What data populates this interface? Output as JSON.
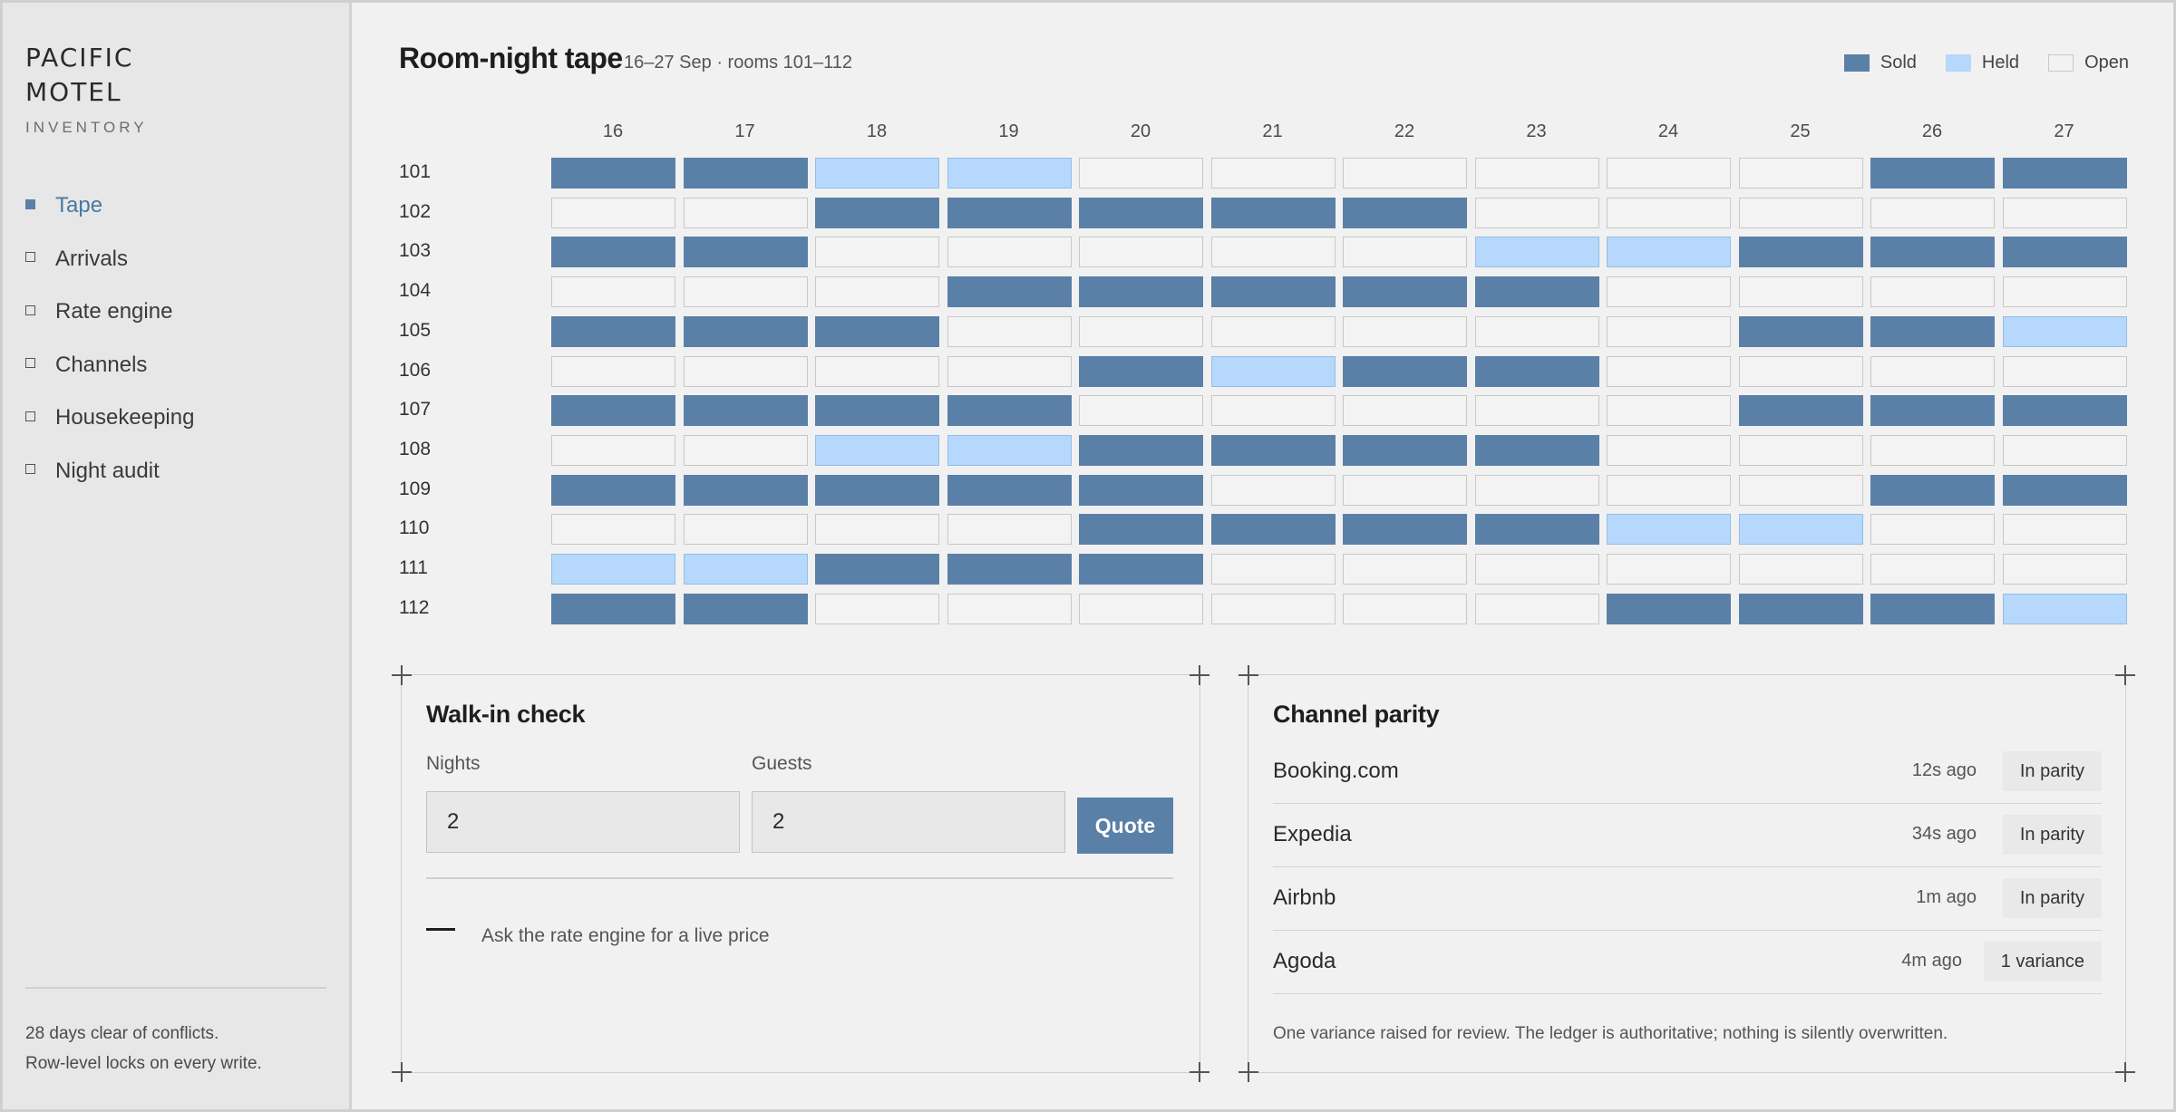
{
  "sidebar": {
    "brand_line1": "PACIFIC",
    "brand_line2": "MOTEL",
    "brand_sub": "INVENTORY",
    "items": [
      {
        "label": "Tape",
        "active": true
      },
      {
        "label": "Arrivals",
        "active": false
      },
      {
        "label": "Rate engine",
        "active": false
      },
      {
        "label": "Channels",
        "active": false
      },
      {
        "label": "Housekeeping",
        "active": false
      },
      {
        "label": "Night audit",
        "active": false
      }
    ],
    "footer_line1": "28 days clear of conflicts.",
    "footer_line2": "Row-level locks on every write."
  },
  "tape": {
    "title": "Room-night tape",
    "subtitle": "16–27 Sep · rooms 101–112",
    "legend": {
      "sold": "Sold",
      "held": "Held",
      "open": "Open"
    },
    "colors": {
      "sold": "#5a80a8",
      "held": "#b5d8fc",
      "open": "#f3f3f3"
    },
    "days": [
      "16",
      "17",
      "18",
      "19",
      "20",
      "21",
      "22",
      "23",
      "24",
      "25",
      "26",
      "27"
    ],
    "rooms": [
      {
        "room": "101",
        "nights": [
          "S",
          "S",
          "H",
          "H",
          "O",
          "O",
          "O",
          "O",
          "O",
          "O",
          "S",
          "S"
        ]
      },
      {
        "room": "102",
        "nights": [
          "O",
          "O",
          "S",
          "S",
          "S",
          "S",
          "S",
          "O",
          "O",
          "O",
          "O",
          "O"
        ]
      },
      {
        "room": "103",
        "nights": [
          "S",
          "S",
          "O",
          "O",
          "O",
          "O",
          "O",
          "H",
          "H",
          "S",
          "S",
          "S"
        ]
      },
      {
        "room": "104",
        "nights": [
          "O",
          "O",
          "O",
          "S",
          "S",
          "S",
          "S",
          "S",
          "O",
          "O",
          "O",
          "O"
        ]
      },
      {
        "room": "105",
        "nights": [
          "S",
          "S",
          "S",
          "O",
          "O",
          "O",
          "O",
          "O",
          "O",
          "S",
          "S",
          "H"
        ]
      },
      {
        "room": "106",
        "nights": [
          "O",
          "O",
          "O",
          "O",
          "S",
          "H",
          "S",
          "S",
          "O",
          "O",
          "O",
          "O"
        ]
      },
      {
        "room": "107",
        "nights": [
          "S",
          "S",
          "S",
          "S",
          "O",
          "O",
          "O",
          "O",
          "O",
          "S",
          "S",
          "S"
        ]
      },
      {
        "room": "108",
        "nights": [
          "O",
          "O",
          "H",
          "H",
          "S",
          "S",
          "S",
          "S",
          "O",
          "O",
          "O",
          "O"
        ]
      },
      {
        "room": "109",
        "nights": [
          "S",
          "S",
          "S",
          "S",
          "S",
          "O",
          "O",
          "O",
          "O",
          "O",
          "S",
          "S"
        ]
      },
      {
        "room": "110",
        "nights": [
          "O",
          "O",
          "O",
          "O",
          "S",
          "S",
          "S",
          "S",
          "H",
          "H",
          "O",
          "O"
        ]
      },
      {
        "room": "111",
        "nights": [
          "H",
          "H",
          "S",
          "S",
          "S",
          "O",
          "O",
          "O",
          "O",
          "O",
          "O",
          "O"
        ]
      },
      {
        "room": "112",
        "nights": [
          "S",
          "S",
          "O",
          "O",
          "O",
          "O",
          "O",
          "O",
          "S",
          "S",
          "S",
          "H"
        ]
      }
    ]
  },
  "walkin": {
    "title": "Walk-in check",
    "nights_label": "Nights",
    "nights_value": "2",
    "guests_label": "Guests",
    "guests_value": "2",
    "quote_label": "Quote",
    "hint": "Ask the rate engine for a live price"
  },
  "parity": {
    "title": "Channel parity",
    "channels": [
      {
        "name": "Booking.com",
        "time": "12s ago",
        "status": "In parity"
      },
      {
        "name": "Expedia",
        "time": "34s ago",
        "status": "In parity"
      },
      {
        "name": "Airbnb",
        "time": "1m ago",
        "status": "In parity"
      },
      {
        "name": "Agoda",
        "time": "4m ago",
        "status": "1 variance"
      }
    ],
    "note": "One variance raised for review. The ledger is authoritative; nothing is silently overwritten."
  }
}
